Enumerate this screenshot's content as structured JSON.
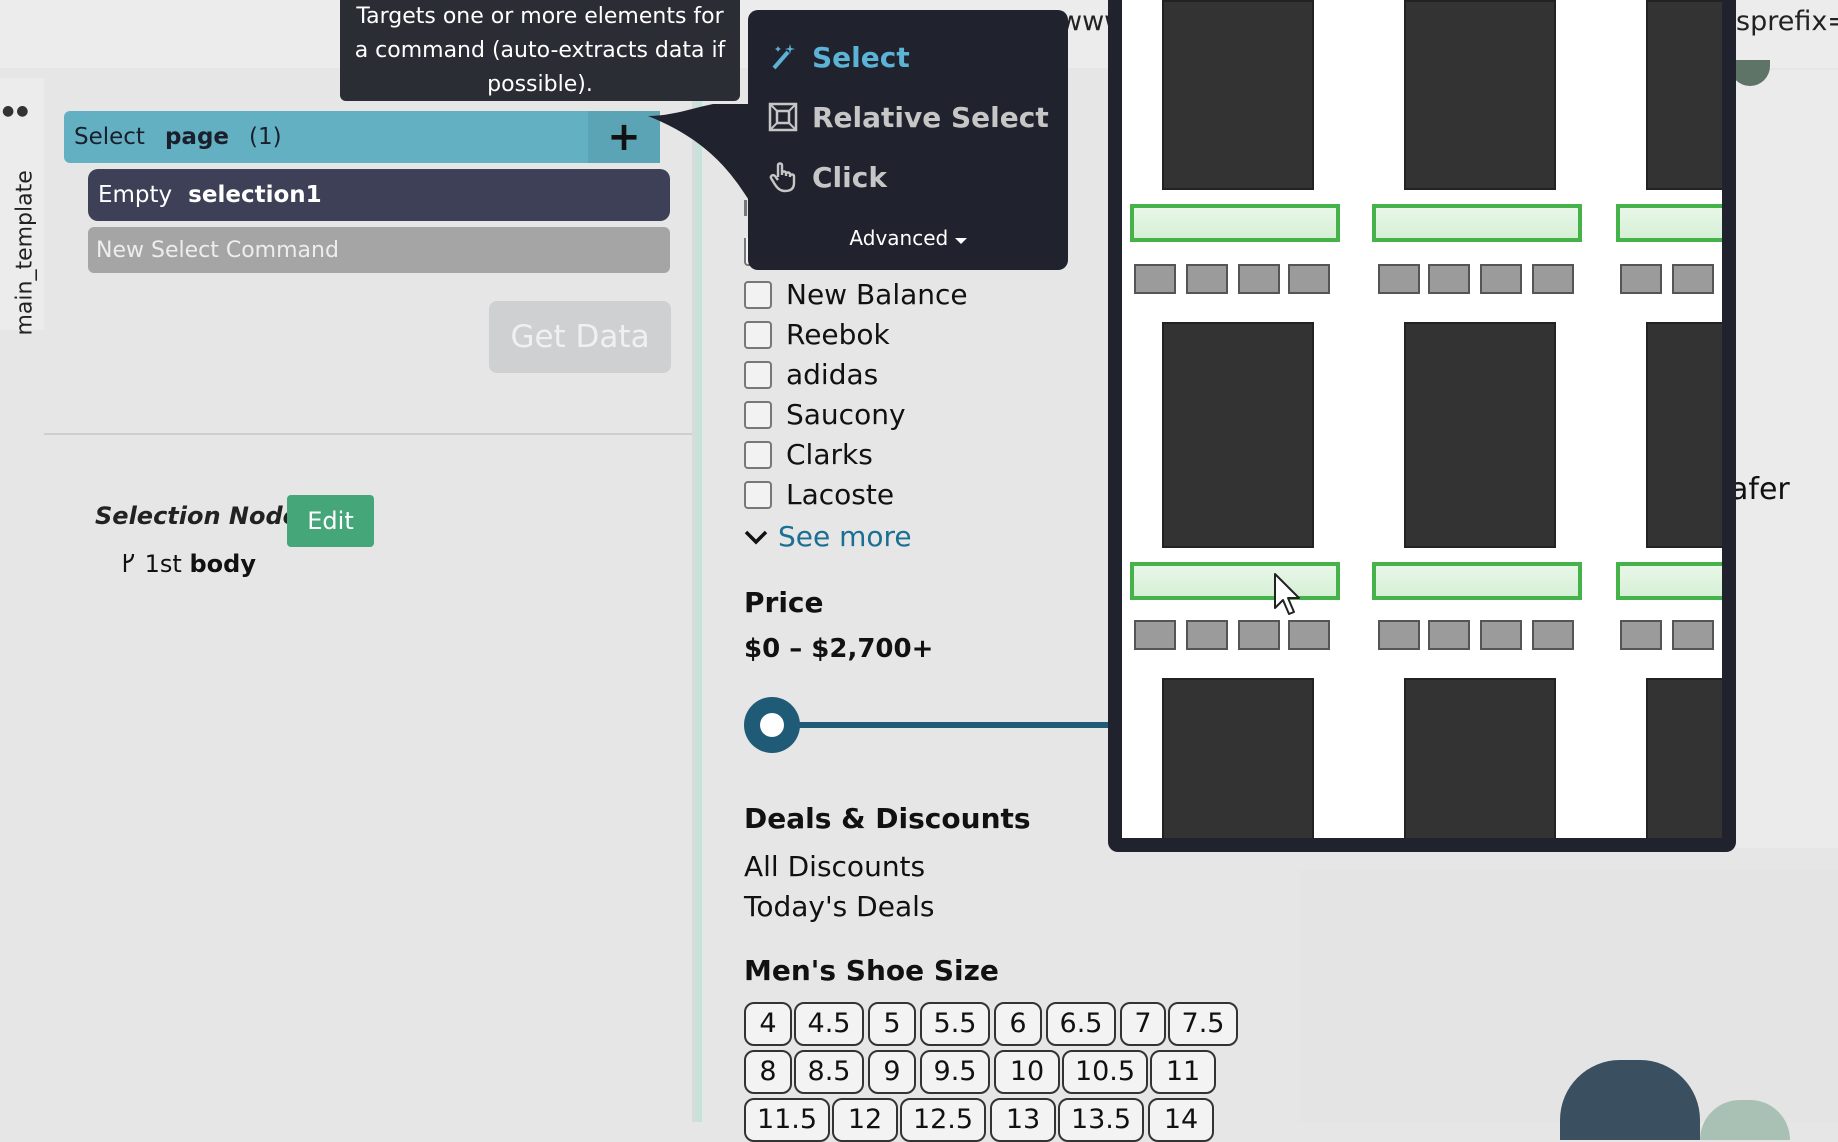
{
  "browser": {
    "url_fragments": [
      "www",
      "sprefix=s"
    ]
  },
  "sidebar": {
    "tab_label": "main_template",
    "select_row": {
      "verb": "Select",
      "object": "page",
      "count": "(1)"
    },
    "plus_label": "+",
    "empty_row": {
      "verb": "Empty",
      "object": "selection1"
    },
    "new_command_label": "New Select Command",
    "get_data_label": "Get Data",
    "selection_node_label": "Selection Node:",
    "edit_label": "Edit",
    "node_path": {
      "prefix": "1st",
      "tag": "body"
    }
  },
  "tooltip": {
    "text": "Targets one or more elements for a command (auto-extracts data if possible)."
  },
  "menu": {
    "items": [
      {
        "label": "Select",
        "icon": "magic-wand-icon"
      },
      {
        "label": "Relative Select",
        "icon": "relative-select-icon"
      },
      {
        "label": "Click",
        "icon": "pointer-hand-icon"
      }
    ],
    "advanced_label": "Advanced"
  },
  "filters": {
    "brands": [
      "New Balance",
      "Reebok",
      "adidas",
      "Saucony",
      "Clarks",
      "Lacoste"
    ],
    "see_more_label": "See more",
    "price_heading": "Price",
    "price_range": "$0 – $2,700+",
    "deals_heading": "Deals & Discounts",
    "deals": [
      "All Discounts",
      "Today's Deals"
    ],
    "size_heading": "Men's Shoe Size",
    "sizes": [
      [
        "4",
        "4.5",
        "5",
        "5.5",
        "6",
        "6.5",
        "7",
        "7.5"
      ],
      [
        "8",
        "8.5",
        "9",
        "9.5",
        "10",
        "10.5",
        "11"
      ],
      [
        "11.5",
        "12",
        "12.5",
        "13",
        "13.5",
        "14"
      ]
    ]
  },
  "right_panel": {
    "text_fragment": "afer"
  },
  "colors": {
    "accent_select": "#63b0c3",
    "selection_row": "#3d4056",
    "menu_bg": "#20232d",
    "menu_active": "#5bb3d6",
    "edit_button": "#45a67a",
    "highlight_green": "#45b24a",
    "link": "#1b6f93"
  }
}
